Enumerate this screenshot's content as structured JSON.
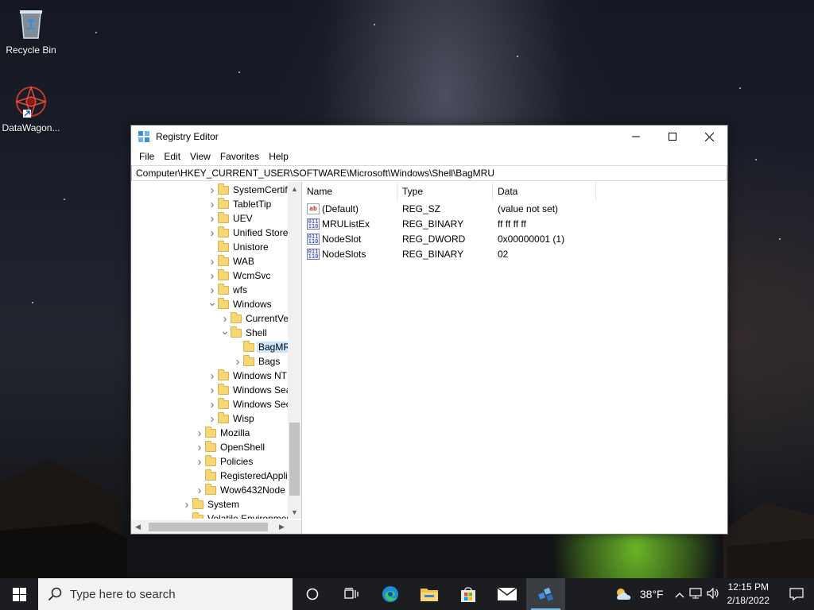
{
  "desktop": {
    "icons": [
      {
        "label": "Recycle Bin",
        "icon": "recycle-bin-icon"
      },
      {
        "label": "DataWagon...",
        "icon": "datawagon-icon"
      }
    ]
  },
  "window": {
    "title": "Registry Editor",
    "menu": [
      "File",
      "Edit",
      "View",
      "Favorites",
      "Help"
    ],
    "address": "Computer\\HKEY_CURRENT_USER\\SOFTWARE\\Microsoft\\Windows\\Shell\\BagMRU"
  },
  "tree": {
    "items": [
      {
        "label": "SystemCertificates",
        "level": 3,
        "expander": ">"
      },
      {
        "label": "TabletTip",
        "level": 3,
        "expander": ">"
      },
      {
        "label": "UEV",
        "level": 3,
        "expander": ">"
      },
      {
        "label": "Unified Store",
        "level": 3,
        "expander": ">"
      },
      {
        "label": "Unistore",
        "level": 3,
        "expander": ""
      },
      {
        "label": "WAB",
        "level": 3,
        "expander": ">"
      },
      {
        "label": "WcmSvc",
        "level": 3,
        "expander": ">"
      },
      {
        "label": "wfs",
        "level": 3,
        "expander": ">"
      },
      {
        "label": "Windows",
        "level": 3,
        "expander": "v"
      },
      {
        "label": "CurrentVersion",
        "level": 4,
        "expander": ">"
      },
      {
        "label": "Shell",
        "level": 4,
        "expander": "v"
      },
      {
        "label": "BagMRU",
        "level": 5,
        "expander": "",
        "selected": true
      },
      {
        "label": "Bags",
        "level": 5,
        "expander": ">"
      },
      {
        "label": "Windows NT",
        "level": 3,
        "expander": ">"
      },
      {
        "label": "Windows Search",
        "level": 3,
        "expander": ">"
      },
      {
        "label": "Windows Security I",
        "level": 3,
        "expander": ">"
      },
      {
        "label": "Wisp",
        "level": 3,
        "expander": ">"
      },
      {
        "label": "Mozilla",
        "level": 2,
        "expander": ">"
      },
      {
        "label": "OpenShell",
        "level": 2,
        "expander": ">"
      },
      {
        "label": "Policies",
        "level": 2,
        "expander": ">"
      },
      {
        "label": "RegisteredApplication",
        "level": 2,
        "expander": ""
      },
      {
        "label": "Wow6432Node",
        "level": 2,
        "expander": ">"
      },
      {
        "label": "System",
        "level": 1,
        "expander": ">"
      },
      {
        "label": "Volatile Environment",
        "level": 1,
        "expander": ""
      }
    ]
  },
  "values": {
    "columns": [
      "Name",
      "Type",
      "Data"
    ],
    "rows": [
      {
        "name": "(Default)",
        "type": "REG_SZ",
        "data": "(value not set)",
        "icon": "string-value-icon"
      },
      {
        "name": "MRUListEx",
        "type": "REG_BINARY",
        "data": "ff ff ff ff",
        "icon": "binary-value-icon"
      },
      {
        "name": "NodeSlot",
        "type": "REG_DWORD",
        "data": "0x00000001 (1)",
        "icon": "binary-value-icon"
      },
      {
        "name": "NodeSlots",
        "type": "REG_BINARY",
        "data": "02",
        "icon": "binary-value-icon"
      }
    ]
  },
  "taskbar": {
    "search_placeholder": "Type here to search",
    "weather": "38°F",
    "time": "12:15 PM",
    "date": "2/18/2022",
    "apps": [
      "task-view-icon",
      "edge-icon",
      "file-explorer-icon",
      "store-icon",
      "mail-icon",
      "regedit-icon"
    ]
  }
}
